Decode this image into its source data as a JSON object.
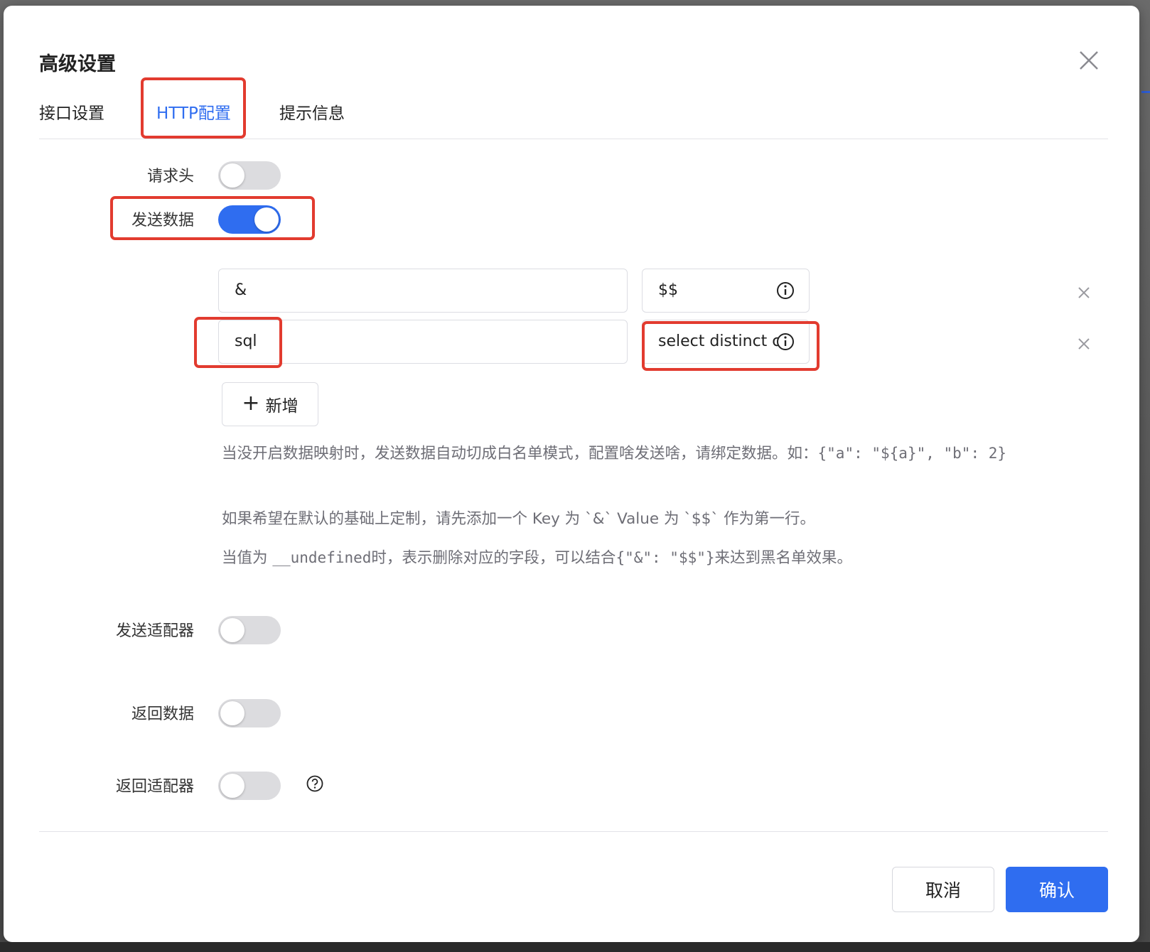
{
  "dialog": {
    "title": "高级设置",
    "close_icon": "close-icon"
  },
  "tabs": [
    {
      "label": "接口设置",
      "active": false
    },
    {
      "label": "HTTP配置",
      "active": true
    },
    {
      "label": "提示信息",
      "active": false
    }
  ],
  "form": {
    "request_headers": {
      "label": "请求头",
      "enabled": false
    },
    "send_data": {
      "label": "发送数据",
      "enabled": true
    },
    "send_adapter": {
      "label": "发送适配器",
      "enabled": false
    },
    "return_data": {
      "label": "返回数据",
      "enabled": false
    },
    "return_adapter": {
      "label": "返回适配器",
      "enabled": false
    }
  },
  "kv_rows": [
    {
      "key": "&",
      "value": "$$"
    },
    {
      "key": "sql",
      "value": "select distinct c"
    }
  ],
  "add_button_label": "新增",
  "help": {
    "line1": "当没开启数据映射时，发送数据自动切成白名单模式，配置啥发送啥，请绑定数据。如：",
    "line1_code": "{\"a\": \"${a}\", \"b\": 2}",
    "line2": "如果希望在默认的基础上定制，请先添加一个 Key 为 `&` Value 为 `$$` 作为第一行。",
    "line3_pre": "当值为 ",
    "line3_code": "__undefined",
    "line3_mid": "时，表示删除对应的字段，可以结合",
    "line3_code2": "{\"&\": \"$$\"}",
    "line3_post": "来达到黑名单效果。"
  },
  "footer": {
    "cancel_label": "取消",
    "confirm_label": "确认"
  },
  "colors": {
    "accent": "#2f6df0",
    "annotation": "#e23b2f"
  }
}
